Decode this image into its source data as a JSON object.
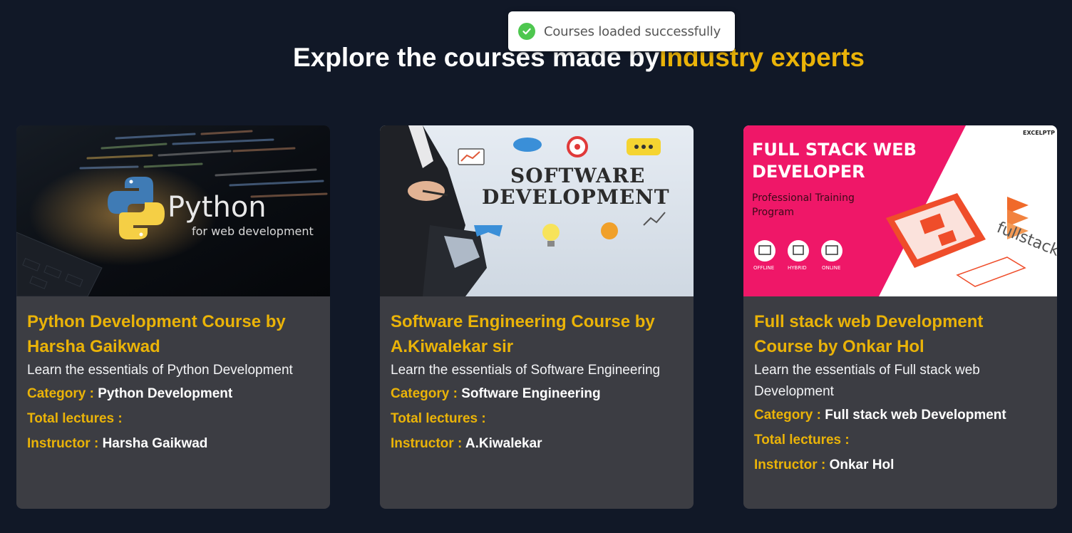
{
  "toast": {
    "icon": "check-circle-icon",
    "message": "Courses loaded successfully"
  },
  "heading": {
    "text": "Explore the courses made by",
    "accent": "Industry experts"
  },
  "labels": {
    "category": "Category : ",
    "lectures": "Total lectures : ",
    "instructor": "Instructor : "
  },
  "courses": [
    {
      "image_text": {
        "title": "Python",
        "subtitle": "for web development"
      },
      "title": "Python Development Course by Harsha Gaikwad",
      "description": "Learn the essentials of Python Development",
      "category": "Python Development",
      "lectures": "",
      "instructor": "Harsha Gaikwad"
    },
    {
      "image_text": {
        "line1": "SOFTWARE",
        "line2": "DEVELOPMENT"
      },
      "title": "Software Engineering Course by A.Kiwalekar sir",
      "description": "Learn the essentials of Software Engineering",
      "category": "Software Engineering",
      "lectures": "",
      "instructor": "A.Kiwalekar"
    },
    {
      "image_text": {
        "line1": "FULL STACK WEB",
        "line2": "DEVELOPER",
        "line3": "Professional Training",
        "line4": "Program",
        "brand": "EXCELPTP",
        "mode1": "OFFLINE",
        "mode2": "HYBRID",
        "mode3": "ONLINE",
        "logo": "fullstack"
      },
      "title": "Full stack web Development Course by Onkar Hol",
      "description": "Learn the essentials of Full stack web Development",
      "category": "Full stack web Development",
      "lectures": "",
      "instructor": "Onkar Hol"
    }
  ],
  "colors": {
    "background": "#111827",
    "card": "#3c3d43",
    "accent": "#eab308",
    "success": "#4ec74f"
  }
}
